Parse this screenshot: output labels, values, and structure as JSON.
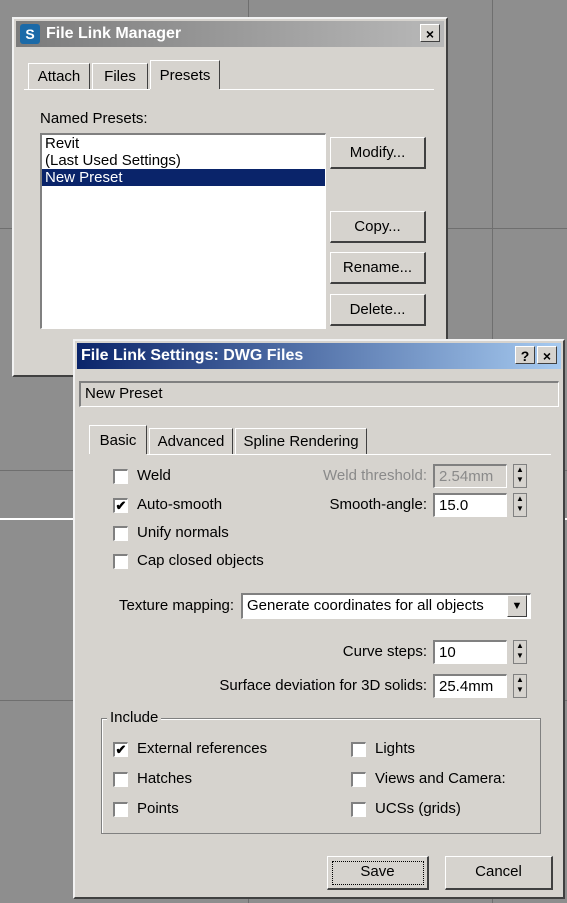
{
  "manager": {
    "title": "File Link Manager",
    "close": "×",
    "tabs": [
      "Attach",
      "Files",
      "Presets"
    ],
    "active_tab": "Presets",
    "named_presets_label": "Named Presets:",
    "presets": [
      "Revit",
      "(Last Used Settings)",
      "New Preset"
    ],
    "selected_preset": "New Preset",
    "buttons": {
      "modify": "Modify...",
      "copy": "Copy...",
      "rename": "Rename...",
      "delete": "Delete..."
    }
  },
  "settings": {
    "title": "File Link Settings: DWG Files",
    "help": "?",
    "close": "×",
    "preset_name": "New Preset",
    "tabs": [
      "Basic",
      "Advanced",
      "Spline Rendering"
    ],
    "active_tab": "Basic",
    "weld": {
      "label": "Weld",
      "checked": false
    },
    "auto_smooth": {
      "label": "Auto-smooth",
      "checked": true
    },
    "unify_normals": {
      "label": "Unify normals",
      "checked": false
    },
    "cap_closed": {
      "label": "Cap closed objects",
      "checked": false
    },
    "weld_threshold": {
      "label": "Weld threshold:",
      "value": "2.54mm",
      "enabled": false
    },
    "smooth_angle": {
      "label": "Smooth-angle:",
      "value": "15.0"
    },
    "texture_mapping": {
      "label": "Texture mapping:",
      "value": "Generate coordinates for all objects"
    },
    "curve_steps": {
      "label": "Curve steps:",
      "value": "10"
    },
    "surface_deviation": {
      "label": "Surface deviation for 3D solids:",
      "value": "25.4mm"
    },
    "include": {
      "title": "Include",
      "external_refs": {
        "label": "External references",
        "checked": true
      },
      "hatches": {
        "label": "Hatches",
        "checked": false
      },
      "points": {
        "label": "Points",
        "checked": false
      },
      "lights": {
        "label": "Lights",
        "checked": false
      },
      "views_cameras": {
        "label": "Views and Camera:",
        "checked": false
      },
      "ucss": {
        "label": "UCSs (grids)",
        "checked": false
      }
    },
    "save": "Save",
    "cancel": "Cancel"
  },
  "glyphs": {
    "check": "✔",
    "up": "▲",
    "down": "▼"
  }
}
